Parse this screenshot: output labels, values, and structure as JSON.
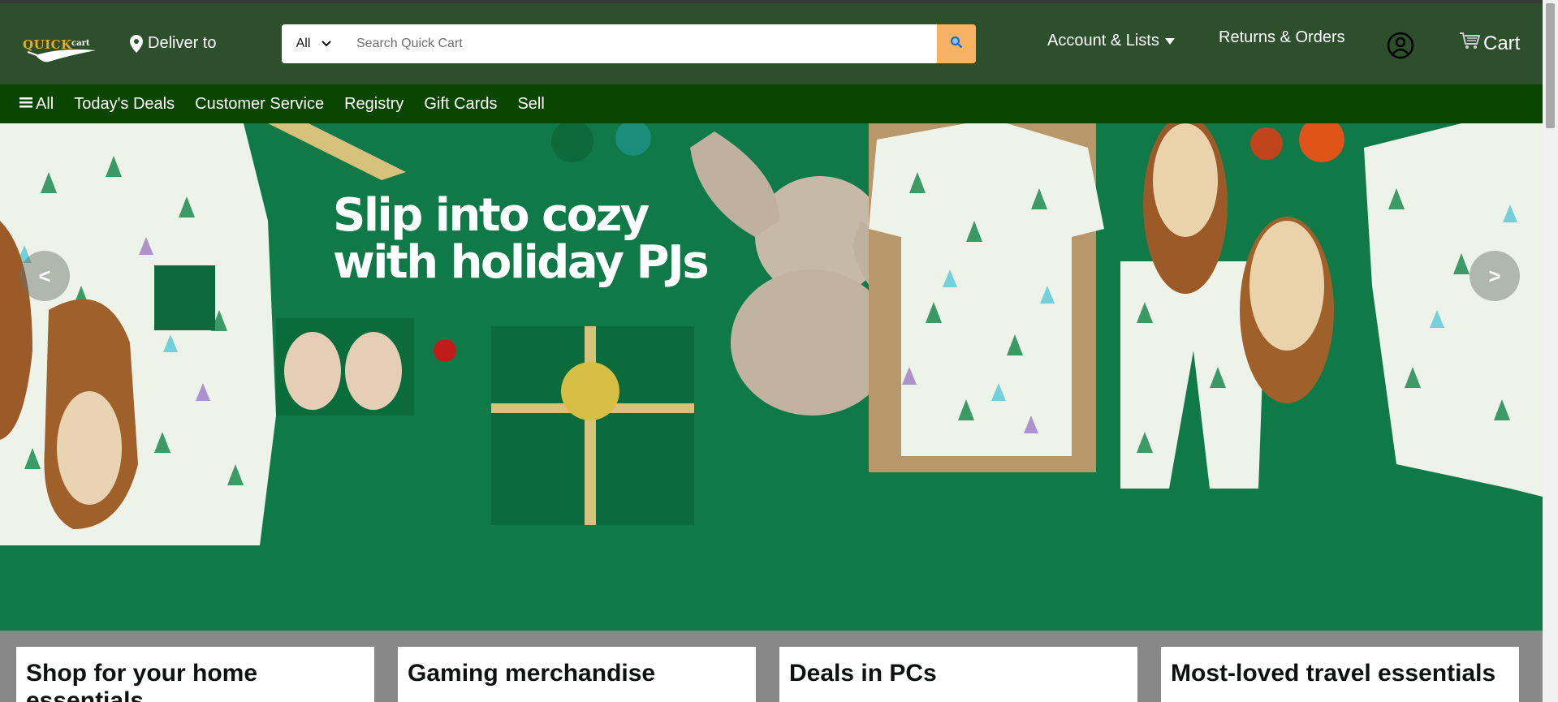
{
  "header": {
    "logo_text": "QUICK cart",
    "deliver_label": "Deliver to",
    "search": {
      "category": "All",
      "placeholder": "Search Quick Cart"
    },
    "account_label": "Account & Lists",
    "returns_label": "Returns & Orders",
    "cart_label": "Cart"
  },
  "subnav": {
    "all_label": "All",
    "items": [
      "Today's Deals",
      "Customer Service",
      "Registry",
      "Gift Cards",
      "Sell"
    ]
  },
  "hero": {
    "headline_line1": "Slip into cozy",
    "headline_line2": "with holiday PJs",
    "prev_label": "<",
    "next_label": ">"
  },
  "cards": [
    {
      "title": "Shop for your home essentials"
    },
    {
      "title": "Gaming merchandise"
    },
    {
      "title": "Deals in PCs"
    },
    {
      "title": "Most-loved travel essentials"
    }
  ],
  "colors": {
    "header_bg": "#2d4f2c",
    "subnav_bg": "#0a4600",
    "hero_bg": "#0f7a47",
    "search_button": "#f8b264",
    "page_bg": "#888888"
  },
  "icons": {
    "location": "location-pin-icon",
    "dropdown": "chevron-down-icon",
    "search": "search-icon",
    "user": "user-circle-icon",
    "cart": "cart-icon",
    "menu": "hamburger-icon"
  }
}
